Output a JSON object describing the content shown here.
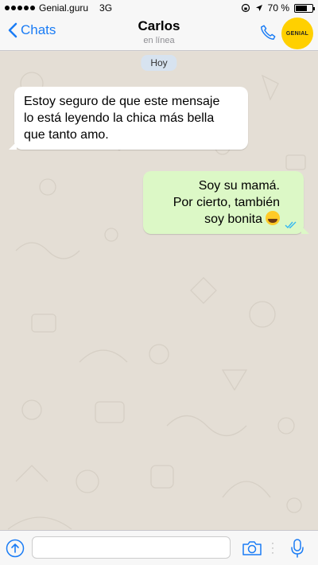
{
  "status_bar": {
    "carrier": "Genial.guru",
    "network": "3G",
    "battery_percent": "70 %",
    "battery_level": 0.7
  },
  "nav": {
    "back_label": "Chats",
    "contact_name": "Carlos",
    "contact_status": "en línea",
    "call_icon": "phone-icon",
    "badge_text": "GENIAL"
  },
  "chat": {
    "date_label": "Hoy",
    "messages": [
      {
        "direction": "incoming",
        "lines": [
          "Estoy seguro de que este mensaje",
          "lo está leyendo la chica más bella",
          "que tanto amo."
        ]
      },
      {
        "direction": "outgoing",
        "lines": [
          "Soy su mamá.",
          "Por cierto, también",
          "soy bonita"
        ],
        "emoji": "face-with-tears-of-joy",
        "status": "read"
      }
    ]
  },
  "input_bar": {
    "upload_icon": "upload-icon",
    "text_value": "",
    "camera_icon": "camera-icon",
    "mic_icon": "mic-icon"
  },
  "colors": {
    "accent": "#1a7cf5",
    "outgoing_bubble": "#dcf8c6",
    "incoming_bubble": "#ffffff",
    "badge": "#ffd000"
  }
}
